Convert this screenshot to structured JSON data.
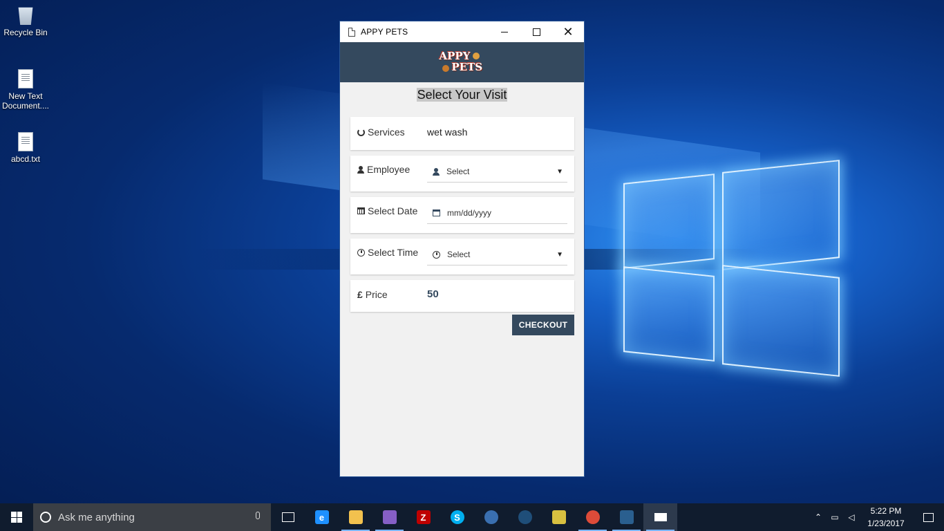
{
  "desktop": {
    "icons": [
      {
        "label": "Recycle Bin"
      },
      {
        "label": "New Text Document...."
      },
      {
        "label": "abcd.txt"
      }
    ]
  },
  "window": {
    "title": "APPY PETS",
    "controls": {
      "close_glyph": "✕"
    }
  },
  "app": {
    "logo": {
      "line1": "APPY",
      "line2": "PETS"
    },
    "page_title": "Select Your Visit",
    "form": {
      "services": {
        "label": "Services",
        "value": "wet wash",
        "icon": "spinner-icon"
      },
      "employee": {
        "label": "Employee",
        "selected": "Select",
        "icon": "user-icon"
      },
      "date": {
        "label": "Select Date",
        "placeholder": "mm/dd/yyyy",
        "icon": "calendar-icon"
      },
      "time": {
        "label": "Select Time",
        "selected": "Select",
        "icon": "clock-icon"
      },
      "price": {
        "label": "Price",
        "currency_symbol": "£",
        "value": "50"
      }
    },
    "checkout_label": "CHECKOUT",
    "colors": {
      "primary": "#34495e",
      "background": "#f1f1f1",
      "title_highlight": "#c8c8c8"
    }
  },
  "taskbar": {
    "search_placeholder": "Ask me anything",
    "apps": [
      {
        "name": "task-view"
      },
      {
        "name": "edge",
        "glyph": "e",
        "color": "#1e90ff"
      },
      {
        "name": "file-explorer",
        "color": "#f2c14e",
        "running": true
      },
      {
        "name": "visual-studio",
        "color": "#865fc5",
        "running": true
      },
      {
        "name": "filezilla",
        "glyph": "Z",
        "color": "#bf0000"
      },
      {
        "name": "skype",
        "glyph": "S",
        "color": "#00aff0"
      },
      {
        "name": "thunderbird",
        "color": "#3a6fb0"
      },
      {
        "name": "sourcetree",
        "color": "#1f4e79"
      },
      {
        "name": "tools",
        "color": "#d8c040"
      },
      {
        "name": "chrome",
        "color": "#dd4b39",
        "running": true
      },
      {
        "name": "mysql-workbench",
        "color": "#2a5f8f",
        "running": true
      },
      {
        "name": "appy-pets-app",
        "running": true,
        "active": true
      }
    ],
    "time": "5:22 PM",
    "date": "1/23/2017"
  }
}
